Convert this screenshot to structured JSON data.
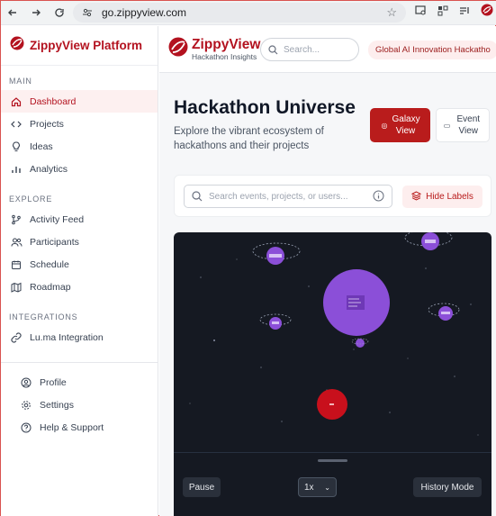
{
  "browser": {
    "url": "go.zippyview.com"
  },
  "sidebar": {
    "brand": "ZippyView Platform",
    "sections": {
      "main": "MAIN",
      "explore": "EXPLORE",
      "integrations": "INTEGRATIONS"
    },
    "main_items": [
      "Dashboard",
      "Projects",
      "Ideas",
      "Analytics"
    ],
    "explore_items": [
      "Activity Feed",
      "Participants",
      "Schedule",
      "Roadmap"
    ],
    "integration_items": [
      "Lu.ma Integration"
    ],
    "bottom_items": [
      "Profile",
      "Settings",
      "Help & Support"
    ]
  },
  "header": {
    "logo_title": "ZippyView",
    "logo_subtitle": "Hackathon Insights",
    "search_placeholder": "Search...",
    "event_chip": "Global AI Innovation Hackatho"
  },
  "page": {
    "title": "Hackathon Universe",
    "subtitle": "Explore the vibrant ecosystem of hackathons and their projects",
    "galaxy_view": "Galaxy View",
    "event_view": "Event View"
  },
  "filters": {
    "search_placeholder": "Search events, projects, or users...",
    "hide_labels": "Hide Labels"
  },
  "controls": {
    "pause": "Pause",
    "speed": "1x",
    "history_mode": "History Mode"
  },
  "colors": {
    "brand": "#b3121f",
    "planet_purple": "#8b4fd8",
    "planet_red": "#c8101c",
    "space": "#151922"
  }
}
